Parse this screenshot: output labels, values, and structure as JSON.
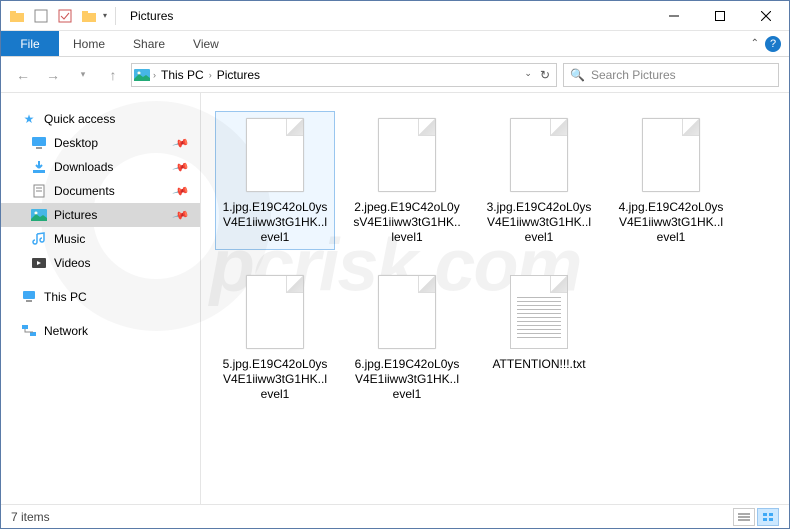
{
  "window": {
    "title": "Pictures"
  },
  "ribbon": {
    "file": "File",
    "tabs": [
      "Home",
      "Share",
      "View"
    ]
  },
  "breadcrumb": {
    "root": "This PC",
    "current": "Pictures"
  },
  "search": {
    "placeholder": "Search Pictures"
  },
  "sidebar": {
    "quick": {
      "label": "Quick access",
      "items": [
        {
          "label": "Desktop",
          "pinned": true,
          "ico": "desktop"
        },
        {
          "label": "Downloads",
          "pinned": true,
          "ico": "downloads"
        },
        {
          "label": "Documents",
          "pinned": true,
          "ico": "documents"
        },
        {
          "label": "Pictures",
          "pinned": true,
          "ico": "pictures",
          "sel": true
        },
        {
          "label": "Music",
          "pinned": false,
          "ico": "music"
        },
        {
          "label": "Videos",
          "pinned": false,
          "ico": "videos"
        }
      ]
    },
    "thispc": {
      "label": "This PC"
    },
    "network": {
      "label": "Network"
    }
  },
  "files": [
    {
      "name": "1.jpg.E19C42oL0ysV4E1iiww3tG1HK..level1",
      "type": "blank",
      "sel": true
    },
    {
      "name": "2.jpeg.E19C42oL0ysV4E1iiww3tG1HK..level1",
      "type": "blank"
    },
    {
      "name": "3.jpg.E19C42oL0ysV4E1iiww3tG1HK..level1",
      "type": "blank"
    },
    {
      "name": "4.jpg.E19C42oL0ysV4E1iiww3tG1HK..level1",
      "type": "blank"
    },
    {
      "name": "5.jpg.E19C42oL0ysV4E1iiww3tG1HK..level1",
      "type": "blank"
    },
    {
      "name": "6.jpg.E19C42oL0ysV4E1iiww3tG1HK..level1",
      "type": "blank"
    },
    {
      "name": "ATTENTION!!!.txt",
      "type": "txt"
    }
  ],
  "status": {
    "count": "7 items"
  },
  "watermark": "pcrisk.com"
}
